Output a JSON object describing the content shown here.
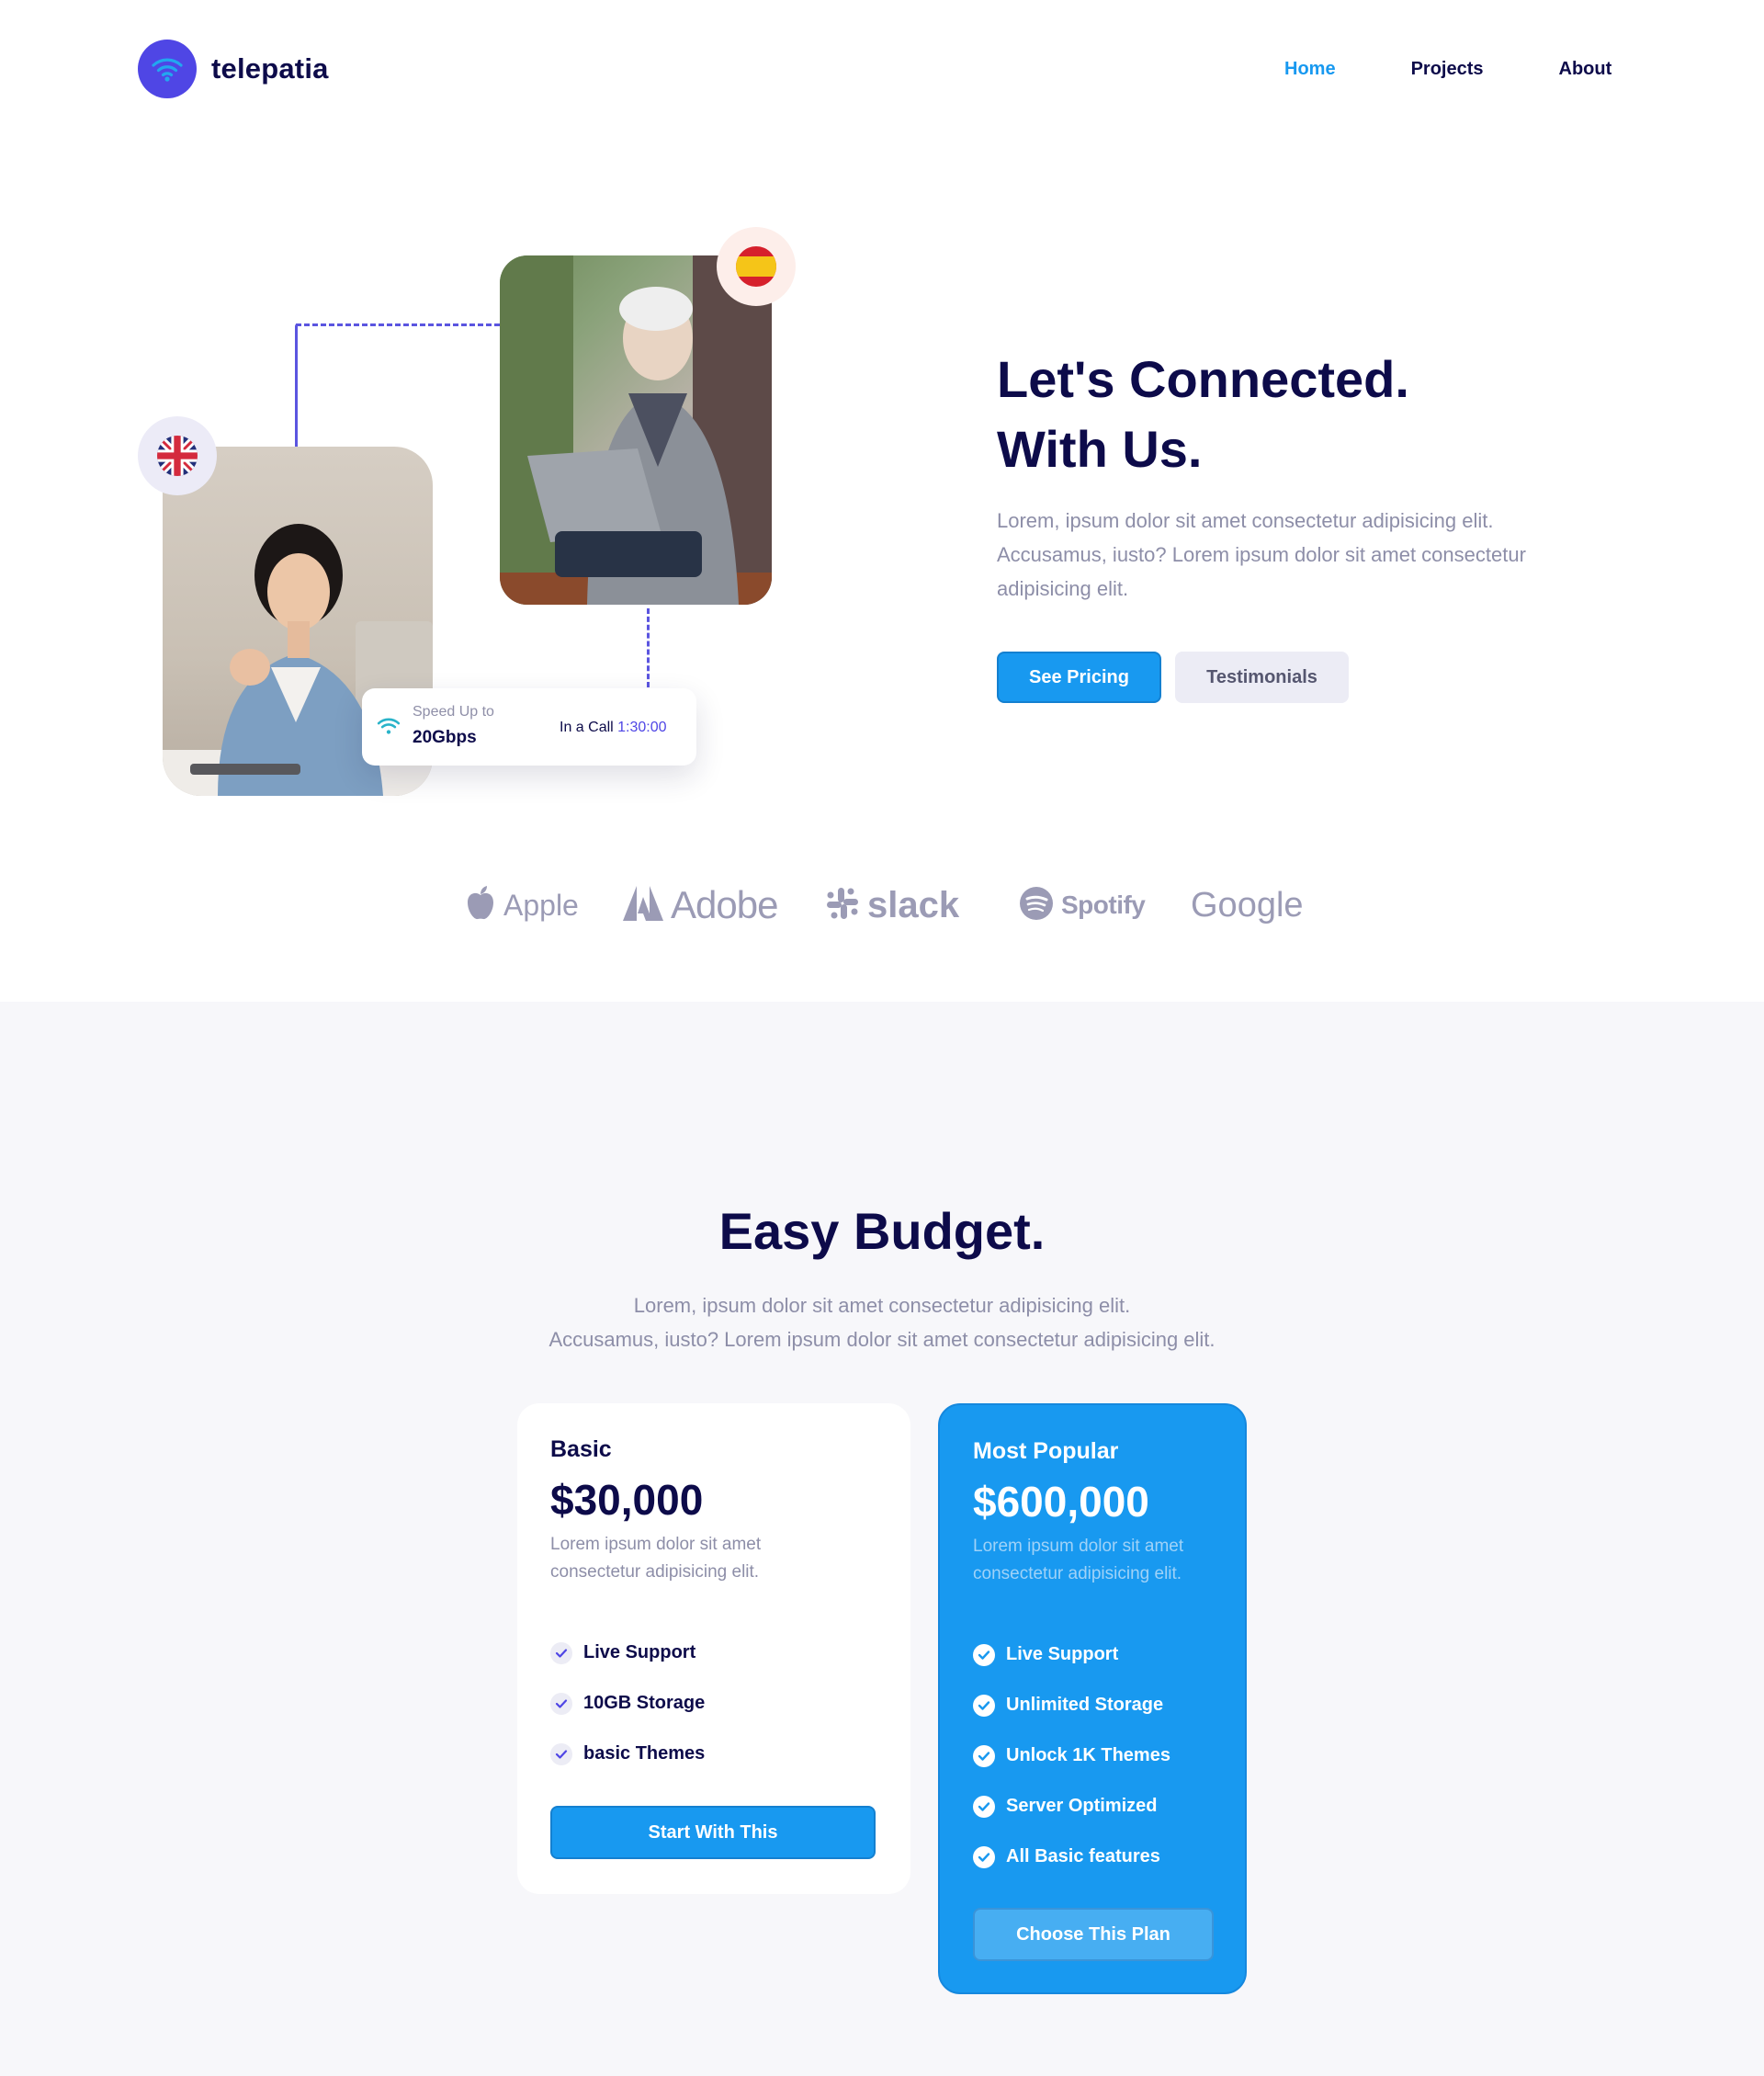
{
  "brand": {
    "name": "telepatia",
    "logo_color": "#4f46e5"
  },
  "nav": {
    "items": [
      {
        "label": "Home",
        "active": true
      },
      {
        "label": "Projects",
        "active": false
      },
      {
        "label": "About",
        "active": false
      }
    ]
  },
  "hero": {
    "title_line1": "Let's Connected.",
    "title_line2": "With Us.",
    "description": "Lorem, ipsum dolor sit amet consectetur adipisicing elit. Accusamus, iusto? Lorem ipsum dolor sit amet consectetur adipisicing elit.",
    "primary_button": "See Pricing",
    "secondary_button": "Testimonials",
    "call_card": {
      "speed_label": "Speed Up to",
      "speed_value": "20Gbps",
      "status_label": "In a Call",
      "call_time": "1:30:00"
    }
  },
  "brands": [
    {
      "name": "Apple",
      "icon": "apple-icon"
    },
    {
      "name": "Adobe",
      "icon": "adobe-icon"
    },
    {
      "name": "slack",
      "icon": "slack-icon"
    },
    {
      "name": "Spotify",
      "icon": "spotify-icon"
    },
    {
      "name": "Google",
      "icon": ""
    }
  ],
  "pricing": {
    "title": "Easy Budget.",
    "desc_line1": "Lorem, ipsum dolor sit amet consectetur adipisicing elit.",
    "desc_line2": "Accusamus, iusto? Lorem ipsum dolor sit amet consectetur adipisicing elit.",
    "plans": [
      {
        "name": "Basic",
        "price": "$30,000",
        "description": "Lorem ipsum dolor sit amet consectetur adipisicing elit.",
        "features": [
          "Live Support",
          "10GB Storage",
          "basic Themes"
        ],
        "button": "Start With This"
      },
      {
        "name": "Most Popular",
        "price": "$600,000",
        "description": "Lorem ipsum dolor sit amet consectetur adipisicing elit.",
        "features": [
          "Live Support",
          "Unlimited Storage",
          "Unlock 1K Themes",
          "Server Optimized",
          "All Basic features"
        ],
        "button": "Choose This Plan"
      }
    ]
  },
  "colors": {
    "primary": "#1899f0",
    "navy": "#0d0b4a",
    "muted": "#8d8ea8",
    "accent": "#4f46e5"
  }
}
